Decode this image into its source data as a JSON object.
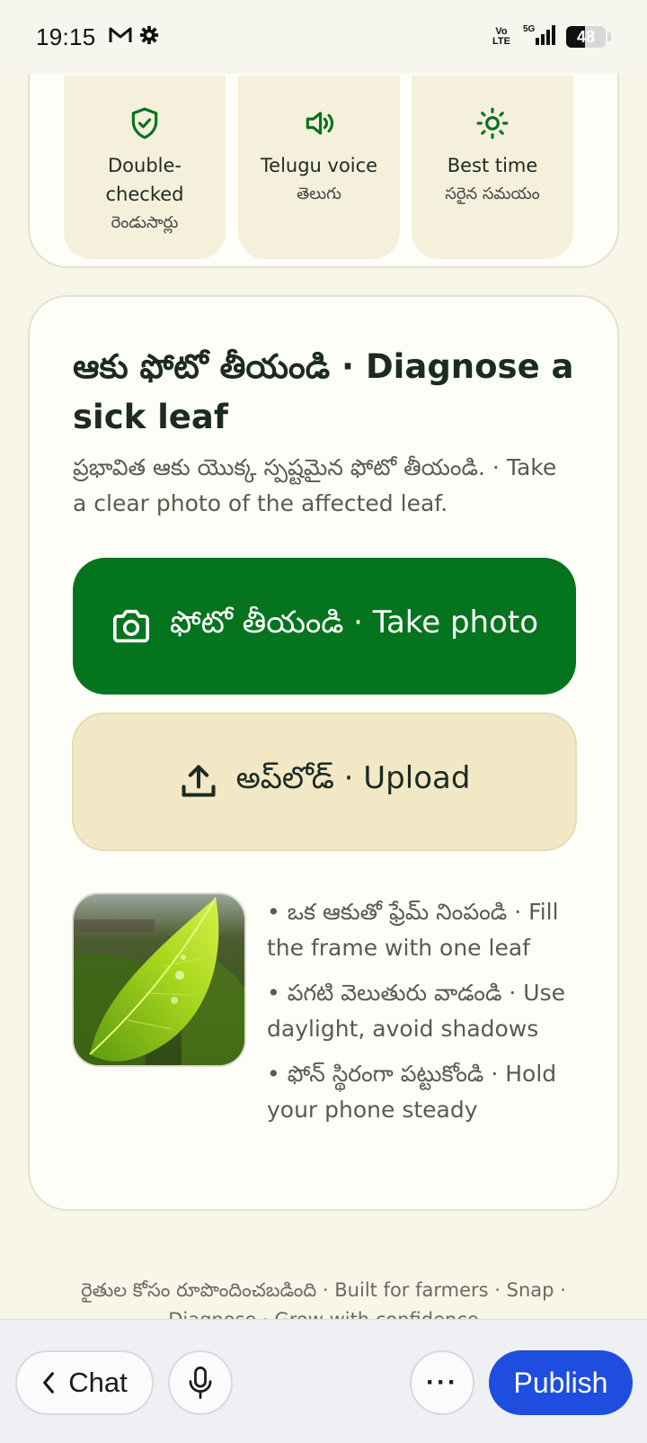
{
  "status_bar": {
    "time": "19:15",
    "network_label": "Vo\nLTE",
    "network_type": "5G",
    "battery_level": "48",
    "battery_fraction": 0.48,
    "left_icons": [
      "gmail-icon",
      "settings-gear-icon"
    ]
  },
  "features": [
    {
      "title": "Double-checked",
      "subtitle": "రెండుసార్లు",
      "icon": "shield-check-icon",
      "color": "#05741f"
    },
    {
      "title": "Telugu voice",
      "subtitle": "తెలుగు",
      "icon": "speaker-icon",
      "color": "#05741f"
    },
    {
      "title": "Best time",
      "subtitle": "సరైన సమయం",
      "icon": "sun-icon",
      "color": "#05741f"
    }
  ],
  "diagnose": {
    "title": "ఆకు ఫోటో తీయండి · Diagnose a sick leaf",
    "subtitle": "ప్రభావిత ఆకు యొక్క స్పష్టమైన ఫోటో తీయండి. · Take a clear photo of the affected leaf.",
    "take_photo_label": "ఫోటో తీయండి · Take photo",
    "upload_label": "అప్‌లోడ్ · Upload",
    "tips": [
      "• ఒక ఆకుతో ఫ్రేమ్ నింపండి · Fill the frame with one leaf",
      "• పగటి వెలుతురు వాడండి · Use daylight, avoid shadows",
      "• ఫోన్ స్థిరంగా పట్టుకోండి · Hold your phone steady"
    ]
  },
  "footer": {
    "text": "రైతుల కోసం రూపొందించబడింది · Built for farmers · Snap ·",
    "text_cut": "Diagnose · Grow with confidence"
  },
  "bottom_bar": {
    "chat_label": "Chat",
    "publish_label": "Publish",
    "more_label": "···"
  },
  "colors": {
    "primary_green": "#05741f",
    "upload_bg": "#f2e8c6",
    "publish_blue": "#1f4de0",
    "page_bg": "#f7f6e8"
  }
}
